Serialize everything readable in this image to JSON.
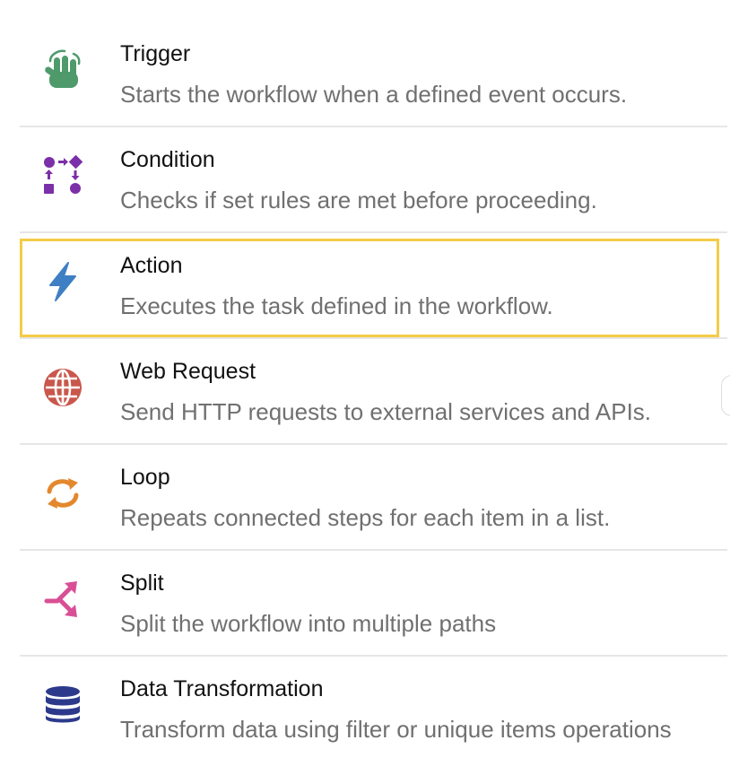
{
  "colors": {
    "highlight_border": "#f4cc47",
    "trigger_icon": "#4e9a6b",
    "condition_icon": "#7b2fa8",
    "action_icon": "#3f7fc4",
    "web_request_icon": "#c9574c",
    "loop_icon": "#e3882d",
    "split_icon": "#d94f96",
    "data_transformation_icon": "#2d3a8c"
  },
  "items": [
    {
      "title": "Trigger",
      "description": "Starts the workflow when a defined event occurs.",
      "icon": "hand-tap-icon"
    },
    {
      "title": "Condition",
      "description": "Checks if set rules are met before proceeding.",
      "icon": "condition-flow-icon"
    },
    {
      "title": "Action",
      "description": "Executes the task defined in the workflow.",
      "icon": "lightning-bolt-icon",
      "selected": true
    },
    {
      "title": "Web Request",
      "description": "Send HTTP requests to external services and APIs.",
      "icon": "globe-icon"
    },
    {
      "title": "Loop",
      "description": "Repeats connected steps for each item in a list.",
      "icon": "refresh-loop-icon"
    },
    {
      "title": "Split",
      "description": "Split the workflow into multiple paths",
      "icon": "split-arrows-icon"
    },
    {
      "title": "Data Transformation",
      "description": "Transform data using filter or unique items operations",
      "icon": "database-icon"
    }
  ]
}
